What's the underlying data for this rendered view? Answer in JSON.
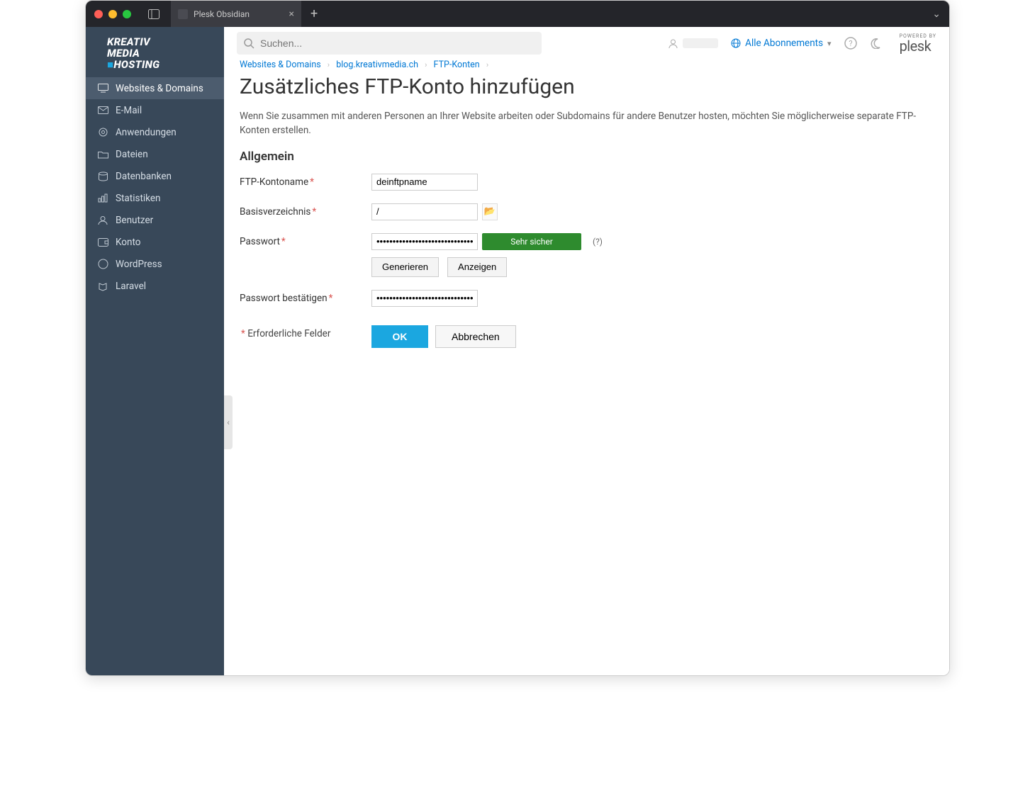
{
  "browser": {
    "tab_title": "Plesk Obsidian"
  },
  "brand": {
    "line1": "KREATIV",
    "line2": "MEDIA",
    "line3_prefix": "■",
    "line3": "HOSTING"
  },
  "sidebar": {
    "items": [
      {
        "label": "Websites & Domains",
        "icon": "monitor-icon",
        "active": true
      },
      {
        "label": "E-Mail",
        "icon": "mail-icon",
        "active": false
      },
      {
        "label": "Anwendungen",
        "icon": "gear-icon",
        "active": false
      },
      {
        "label": "Dateien",
        "icon": "folder-icon",
        "active": false
      },
      {
        "label": "Datenbanken",
        "icon": "stack-icon",
        "active": false
      },
      {
        "label": "Statistiken",
        "icon": "barstat-icon",
        "active": false
      },
      {
        "label": "Benutzer",
        "icon": "user-icon",
        "active": false
      },
      {
        "label": "Konto",
        "icon": "wallet-icon",
        "active": false
      },
      {
        "label": "WordPress",
        "icon": "wordpress-icon",
        "active": false
      },
      {
        "label": "Laravel",
        "icon": "laravel-icon",
        "active": false
      }
    ]
  },
  "topbar": {
    "search_placeholder": "Suchen...",
    "subscriptions_label": "Alle Abonnements",
    "powered_by_small": "POWERED BY",
    "powered_by_brand": "plesk"
  },
  "breadcrumbs": [
    {
      "label": "Websites & Domains"
    },
    {
      "label": "blog.kreativmedia.ch"
    },
    {
      "label": "FTP-Konten"
    }
  ],
  "page": {
    "title": "Zusätzliches FTP-Konto hinzufügen",
    "description": "Wenn Sie zusammen mit anderen Personen an Ihrer Website arbeiten oder Subdomains für andere Benutzer hosten, möchten Sie möglicherweise separate FTP-Konten erstellen.",
    "section_allgemein": "Allgemein",
    "required_note": "Erforderliche Felder"
  },
  "form": {
    "ftp_name_label": "FTP-Kontoname",
    "ftp_name_value": "deinftpname",
    "basedir_label": "Basisverzeichnis",
    "basedir_value": "/",
    "password_label": "Passwort",
    "password_value": "••••••••••••••••••••••••••••••••",
    "strength_text": "Sehr sicher",
    "help_q": "(?)",
    "generate_btn": "Generieren",
    "show_btn": "Anzeigen",
    "password_confirm_label": "Passwort bestätigen",
    "password_confirm_value": "••••••••••••••••••••••••••••••••",
    "ok_btn": "OK",
    "cancel_btn": "Abbrechen"
  }
}
